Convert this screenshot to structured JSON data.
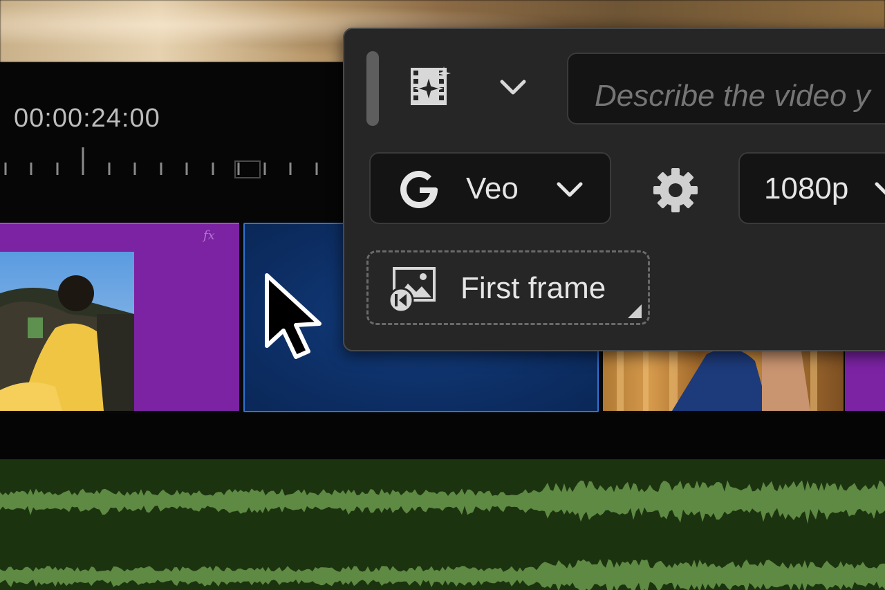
{
  "timeline": {
    "timecode": "00:00:24:00",
    "clip_fx_label": "fx"
  },
  "generate_panel": {
    "media_type_icon": "film-sparkle-icon",
    "prompt_placeholder": "Describe the video y",
    "model": {
      "provider_icon": "google-g-icon",
      "label": "Veo"
    },
    "settings_icon": "gear-icon",
    "resolution": "1080p",
    "first_frame": {
      "icon": "image-first-frame-icon",
      "label": "First frame"
    }
  },
  "colors": {
    "panel_bg": "#262626",
    "field_bg": "#141414",
    "purple_clip": "#7b23a3",
    "selected_clip": "#0d2f66",
    "selection_border": "#2f73d6",
    "audio_track": "#1c3310",
    "waveform": "#5e8a43"
  }
}
